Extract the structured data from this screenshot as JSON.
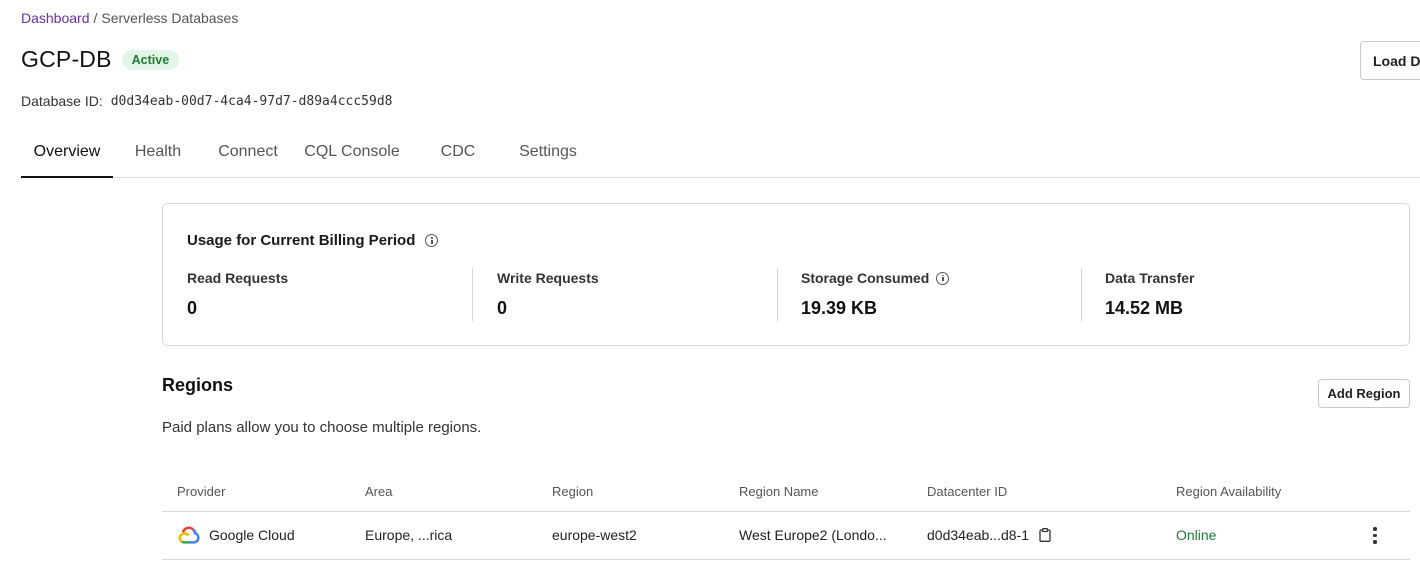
{
  "breadcrumb": {
    "root": "Dashboard",
    "separator": "/",
    "current": "Serverless Databases"
  },
  "database": {
    "name": "GCP-DB",
    "status": "Active",
    "id_label": "Database ID:",
    "id_value": "d0d34eab-00d7-4ca4-97d7-d89a4ccc59d8"
  },
  "header": {
    "load_button": "Load D"
  },
  "tabs": [
    {
      "label": "Overview",
      "active": true
    },
    {
      "label": "Health"
    },
    {
      "label": "Connect"
    },
    {
      "label": "CQL Console"
    },
    {
      "label": "CDC"
    },
    {
      "label": "Settings"
    }
  ],
  "usage": {
    "title": "Usage for Current Billing Period",
    "stats": [
      {
        "label": "Read Requests",
        "value": "0"
      },
      {
        "label": "Write Requests",
        "value": "0"
      },
      {
        "label": "Storage Consumed",
        "value": "19.39 KB"
      },
      {
        "label": "Data Transfer",
        "value": "14.52 MB"
      }
    ]
  },
  "regions": {
    "title": "Regions",
    "subtitle": "Paid plans allow you to choose multiple regions.",
    "add_button": "Add Region",
    "columns": [
      "Provider",
      "Area",
      "Region",
      "Region Name",
      "Datacenter ID",
      "Region Availability"
    ],
    "rows": [
      {
        "provider": "Google Cloud",
        "area": "Europe, ...rica",
        "region": "europe-west2",
        "region_name": "West Europe2 (Londo...",
        "datacenter_id": "d0d34eab...d8-1",
        "availability": "Online"
      }
    ]
  },
  "colors": {
    "accent": "#6b2fa8",
    "success": "#1e7a37",
    "badge_bg": "#e3f5e6",
    "border": "#d6d6d6"
  },
  "icons": [
    "info-icon",
    "google-cloud-icon",
    "clipboard-icon",
    "kebab-menu-icon"
  ]
}
